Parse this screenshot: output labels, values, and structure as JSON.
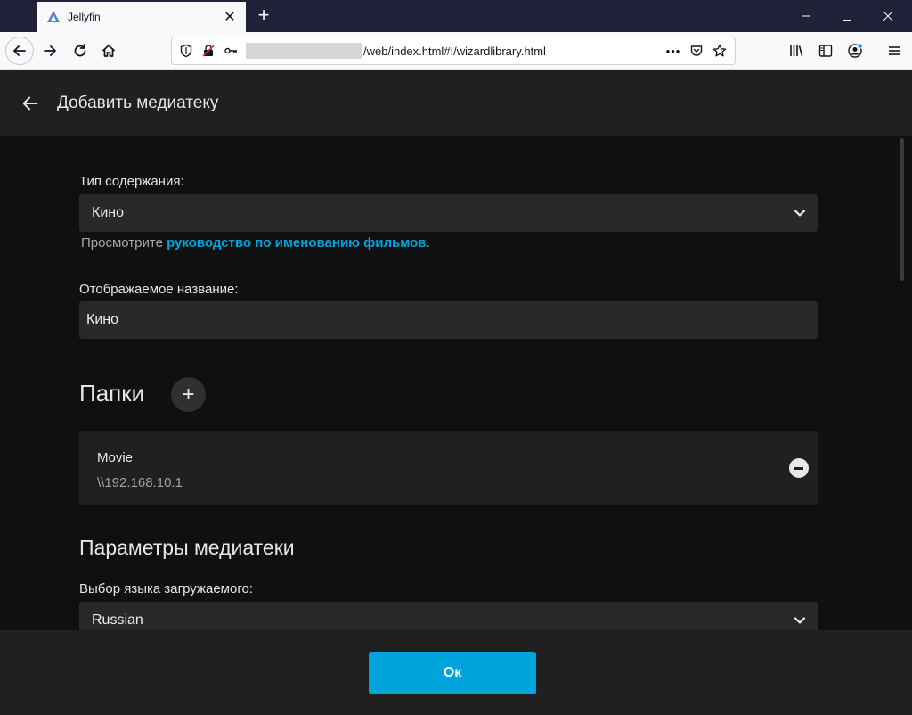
{
  "browser": {
    "tab_title": "Jellyfin",
    "tab_close": "✕",
    "new_tab": "+",
    "url": "/web/index.html#!/wizardlibrary.html",
    "url_more": "•••"
  },
  "app": {
    "header_title": "Добавить медиатеку"
  },
  "form": {
    "content_type_label": "Тип содержания:",
    "content_type_value": "Кино",
    "hint_prefix": "Просмотрите ",
    "hint_link": "руководство по именованию фильмов",
    "hint_suffix": ".",
    "display_name_label": "Отображаемое название:",
    "display_name_value": "Кино",
    "folders_heading": "Папки",
    "add_folder": "+",
    "folder": {
      "name": "Movie",
      "path": "\\\\192.168.10.1"
    },
    "library_options_heading": "Параметры медиатеки",
    "metadata_language_label": "Выбор языка загружаемого:",
    "metadata_language_value": "Russian"
  },
  "footer": {
    "ok_label": "Ок"
  },
  "colors": {
    "accent": "#00a4dc",
    "background": "#101010",
    "header": "#202020",
    "tabbar": "#20223a"
  }
}
